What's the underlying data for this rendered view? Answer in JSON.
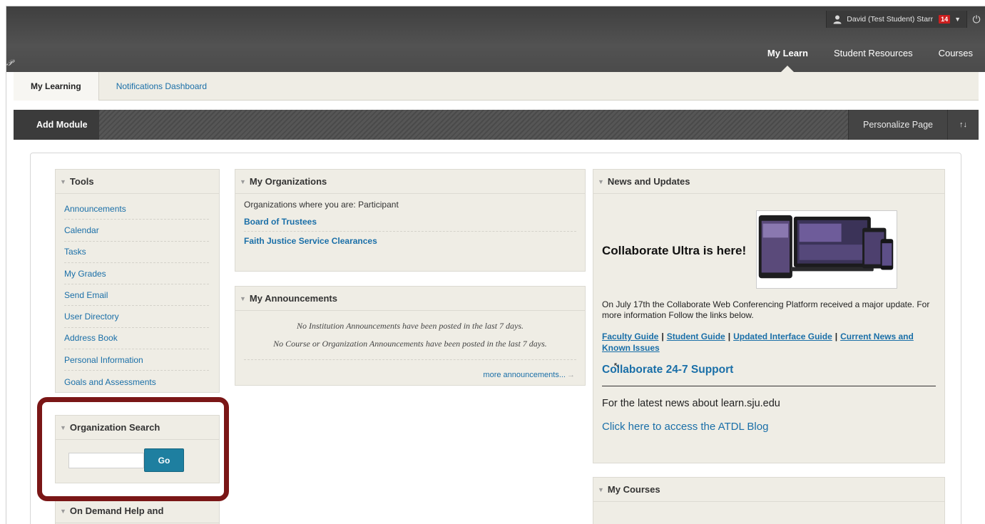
{
  "header": {
    "user_name": "David (Test Student) Starr",
    "notification_count": "14",
    "tabs": [
      "My Learn",
      "Student Resources",
      "Courses"
    ]
  },
  "subnav": {
    "tabs": [
      "My Learning",
      "Notifications Dashboard"
    ]
  },
  "module_bar": {
    "add_module": "Add Module",
    "personalize": "Personalize Page",
    "sort_symbol": "↑↓"
  },
  "tools": {
    "title": "Tools",
    "items": [
      "Announcements",
      "Calendar",
      "Tasks",
      "My Grades",
      "Send Email",
      "User Directory",
      "Address Book",
      "Personal Information",
      "Goals and Assessments"
    ]
  },
  "org_search": {
    "title": "Organization Search",
    "go": "Go"
  },
  "on_demand": {
    "title": "On Demand Help and"
  },
  "my_orgs": {
    "title": "My Organizations",
    "intro": "Organizations where you are: Participant",
    "orgs": [
      "Board of Trustees",
      "Faith Justice Service Clearances"
    ]
  },
  "my_announcements": {
    "title": "My Announcements",
    "line1": "No Institution Announcements have been posted in the last 7 days.",
    "line2": "No Course or Organization Announcements have been posted in the last 7 days.",
    "more": "more announcements..."
  },
  "news": {
    "title": "News and Updates",
    "headline": "Collaborate Ultra is here!",
    "body": "On July 17th  the Collaborate Web Conferencing Platform received a major update. For more information Follow the links below.",
    "links": [
      "Faculty Guide",
      "Student Guide",
      "Updated Interface Guide",
      "Current News and Known Issues"
    ],
    "support": "Collaborate 24-7 Support",
    "latest": "For the latest news about learn.sju.edu",
    "blog": "Click here to access the ATDL Blog"
  },
  "my_courses": {
    "title": "My Courses"
  },
  "colors": {
    "accent": "#1a6fa8",
    "go_button": "#1e7fa0",
    "highlight": "#7a1616",
    "module_bg": "#efede5"
  }
}
